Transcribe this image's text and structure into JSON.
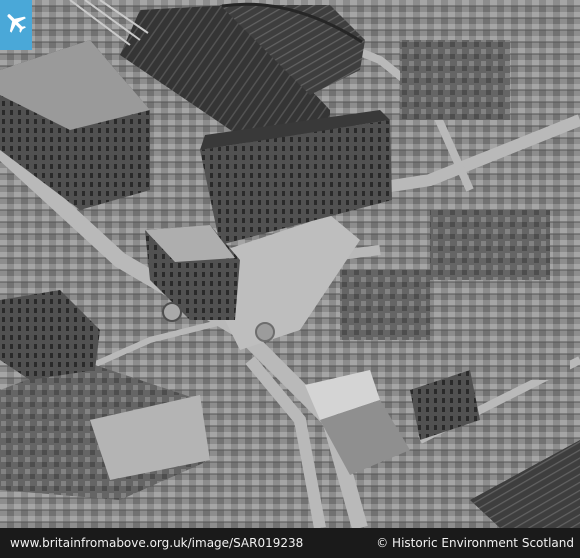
{
  "footer": {
    "url_text": "www.britainfromabove.org.uk/image/SAR019238",
    "copyright_text": "© Historic Environment Scotland"
  },
  "logo": {
    "icon": "airplane-icon",
    "color": "#4aa8d8"
  }
}
